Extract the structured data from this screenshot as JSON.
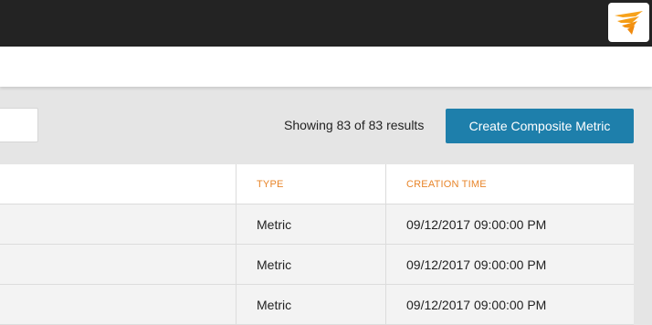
{
  "topbar": {
    "logo_icon": "solarwinds-logo-icon",
    "logo_color": "#f7a21b"
  },
  "toolbar": {
    "results_text": "Showing 83 of 83 results",
    "create_button_label": "Create Composite Metric",
    "create_button_color": "#1e7fab"
  },
  "table": {
    "columns": [
      "TYPE",
      "CREATION TIME"
    ],
    "header_color": "#e8852a",
    "rows": [
      {
        "type": "Metric",
        "creation_time": "09/12/2017 09:00:00 PM"
      },
      {
        "type": "Metric",
        "creation_time": "09/12/2017 09:00:00 PM"
      },
      {
        "type": "Metric",
        "creation_time": "09/12/2017 09:00:00 PM"
      }
    ]
  }
}
